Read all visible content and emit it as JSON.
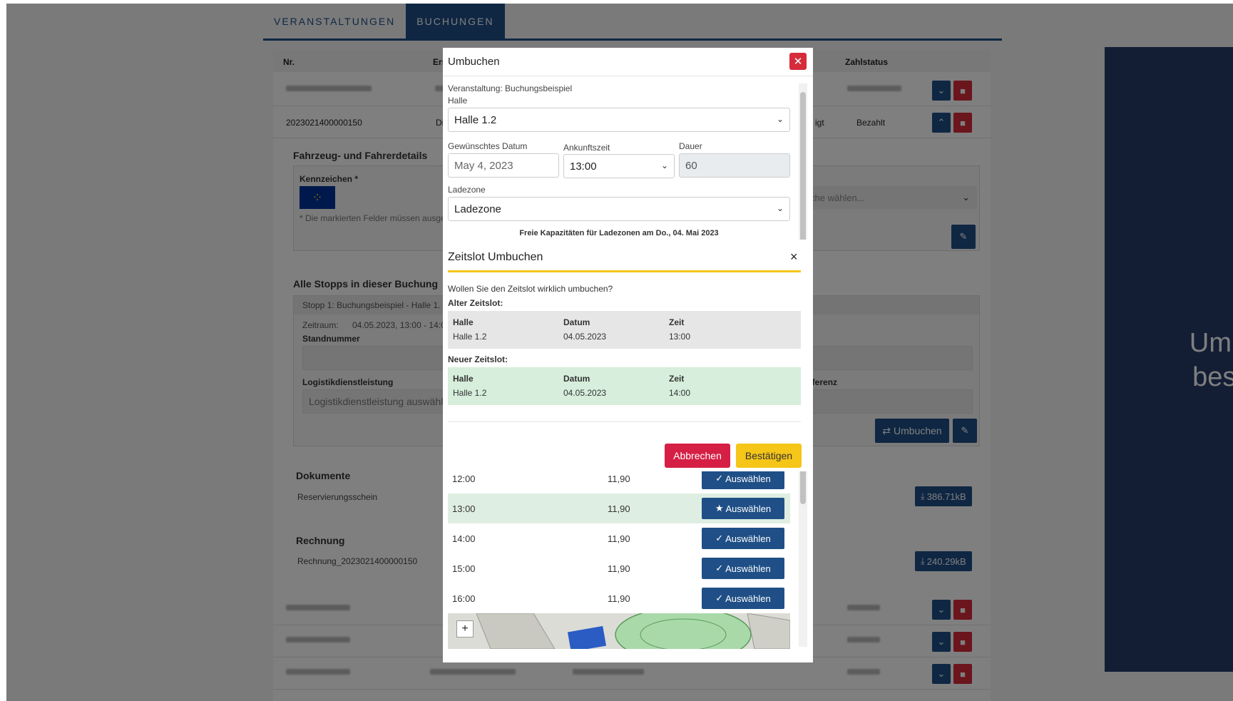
{
  "tabs": [
    {
      "label": "VERANSTALTUNGEN",
      "active": false
    },
    {
      "label": "BUCHUNGEN",
      "active": true
    }
  ],
  "table": {
    "columns": {
      "nr": "Nr.",
      "erst": "Erst",
      "zahlstatus": "Zahlstatus"
    },
    "booking": {
      "nr": "2023021400000150",
      "date_prefix": "Di.",
      "status_suffix": "igt",
      "payment": "Bezahlt"
    }
  },
  "details": {
    "vehicle_title": "Fahrzeug- und Fahrerdetails",
    "plate_label": "Kennzeichen *",
    "required_note": "* Die markierten Felder müssen ausge",
    "select_placeholder": "che wählen...",
    "stops_title": "Alle Stopps in dieser Buchung",
    "stop_header": "Stopp 1:  Buchungsbeispiel - Halle 1.",
    "period_label": "Zeitraum:",
    "period_value": "04.05.2023, 13:00 - 14:0",
    "stand_label": "Standnummer",
    "logistics_label": "Logistikdienstleistung",
    "logistics_placeholder": "Logistikdienstleistung auswähl",
    "reference_label": "eferenz",
    "rebook_button": "Umbuchen",
    "documents_title": "Dokumente",
    "document_name": "Reservierungsschein",
    "document_size": "386.71kB",
    "invoice_title": "Rechnung",
    "invoice_name": "Rechnung_2023021400000150",
    "invoice_size": "240.29kB"
  },
  "rebook_modal": {
    "title": "Umbuchen",
    "event_label": "Veranstaltung: Buchungsbeispiel",
    "hall_label": "Halle",
    "hall_value": "Halle 1.2",
    "date_label": "Gewünschtes Datum",
    "date_value": "May 4, 2023",
    "arrival_label": "Ankunftszeit",
    "arrival_value": "13:00",
    "duration_label": "Dauer",
    "duration_value": "60",
    "zone_label": "Ladezone",
    "zone_value": "Ladezone",
    "capacity_heading": "Freie Kapazitäten für Ladezonen am Do., 04. Mai 2023",
    "select_label": "Auswählen",
    "slots": [
      {
        "time": "12:00",
        "price": "11,90",
        "current": false
      },
      {
        "time": "13:00",
        "price": "11,90",
        "current": true
      },
      {
        "time": "14:00",
        "price": "11,90",
        "current": false
      },
      {
        "time": "15:00",
        "price": "11,90",
        "current": false
      },
      {
        "time": "16:00",
        "price": "11,90",
        "current": false
      }
    ],
    "map_zoom_in": "+"
  },
  "confirm_modal": {
    "title": "Zeitslot Umbuchen",
    "close": "×",
    "question": "Wollen Sie den Zeitslot wirklich umbuchen?",
    "old_label": "Alter Zeitslot:",
    "new_label": "Neuer Zeitslot:",
    "col_hall": "Halle",
    "col_date": "Datum",
    "col_time": "Zeit",
    "old": {
      "hall": "Halle 1.2",
      "date": "04.05.2023",
      "time": "13:00"
    },
    "new": {
      "hall": "Halle 1.2",
      "date": "04.05.2023",
      "time": "14:00"
    },
    "cancel": "Abbrechen",
    "confirm": "Bestätigen"
  },
  "side_panel": {
    "line1": "Umb",
    "line2": "best"
  },
  "colors": {
    "primary": "#1f4f86",
    "danger": "#d62b3a",
    "warning": "#f5c518",
    "highlight": "#d6eedb",
    "side_panel": "#273c6b"
  }
}
